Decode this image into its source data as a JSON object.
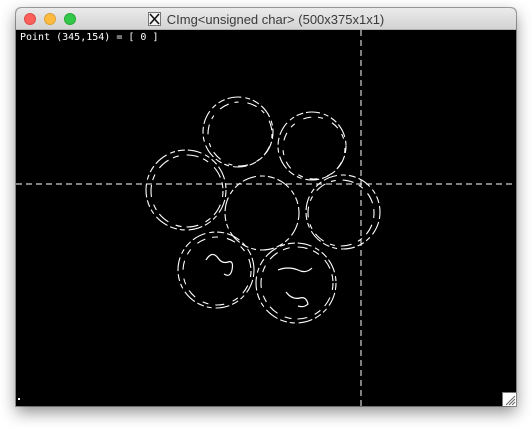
{
  "window": {
    "title": "CImg<unsigned char> (500x375x1x1)",
    "title_icon": "x11-icon",
    "controls": [
      "close",
      "minimize",
      "maximize"
    ]
  },
  "status": {
    "text": "Point (345,154) = [ 0 ]"
  },
  "colors": {
    "background": "#000000",
    "foreground": "#ffffff",
    "close": "#fc605b",
    "minimize": "#fdbc40",
    "maximize": "#34c84a"
  }
}
